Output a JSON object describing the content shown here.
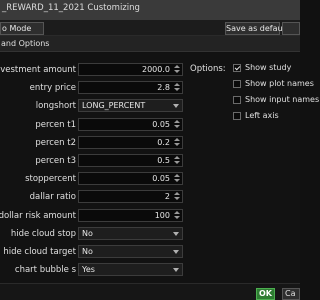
{
  "window": {
    "title": "_REWARD_11_2021 Customizing"
  },
  "toolbar": {
    "mode_label": "o Mode",
    "save_default_label": "Save as default"
  },
  "section": {
    "title": "and Options"
  },
  "inputs": [
    {
      "label": "investment amount",
      "type": "number",
      "value": "2000.0"
    },
    {
      "label": "entry price",
      "type": "number",
      "value": "2.8"
    },
    {
      "label": "longshort",
      "type": "select",
      "value": "LONG_PERCENT"
    },
    {
      "label": "percen t1",
      "type": "number",
      "value": "0.05"
    },
    {
      "label": "percen t2",
      "type": "number",
      "value": "0.2"
    },
    {
      "label": "percen t3",
      "type": "number",
      "value": "0.5"
    },
    {
      "label": "stoppercent",
      "type": "number",
      "value": "0.05"
    },
    {
      "label": "dallar ratio",
      "type": "number",
      "value": "2"
    },
    {
      "label": "dollar risk amount",
      "type": "number",
      "value": "100"
    },
    {
      "label": "hide cloud stop",
      "type": "select",
      "value": "No"
    },
    {
      "label": "hide cloud target",
      "type": "select",
      "value": "No"
    },
    {
      "label": "chart bubble s",
      "type": "select",
      "value": "Yes"
    }
  ],
  "options": {
    "label": "Options:",
    "items": [
      {
        "label": "Show study",
        "checked": true
      },
      {
        "label": "Show plot names",
        "checked": false
      },
      {
        "label": "Show input names",
        "checked": false
      },
      {
        "label": "Left axis",
        "checked": false
      }
    ]
  },
  "footer": {
    "ok_label": "OK",
    "cancel_label": "Ca"
  },
  "colors": {
    "background": "#111111",
    "titlebar": "#3a3a3a",
    "ok_button": "#2e7d32"
  },
  "icons": {
    "spinner": "spinner-arrows-icon",
    "dropdown": "chevron-down-icon",
    "check": "checkmark-icon"
  }
}
